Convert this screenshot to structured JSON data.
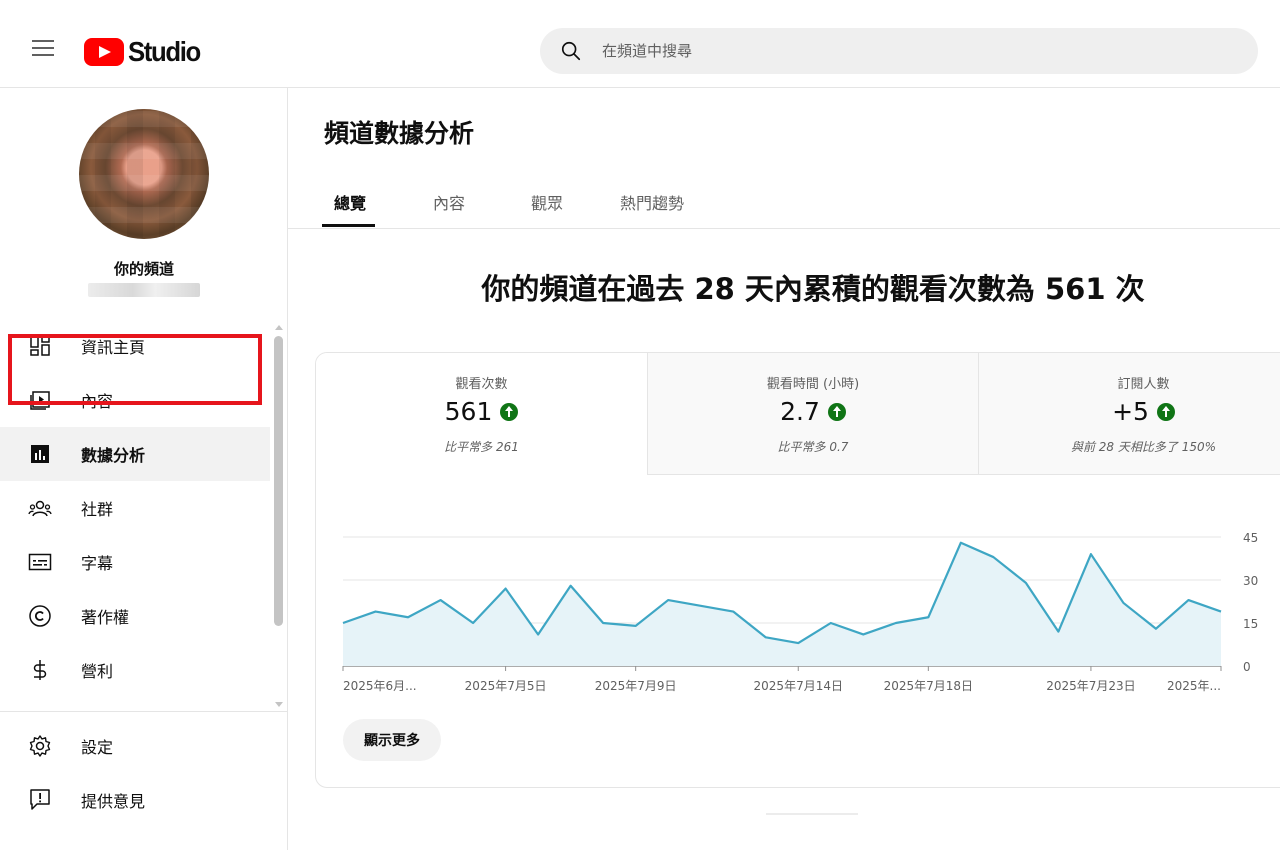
{
  "header": {
    "logo_text": "Studio",
    "search_placeholder": "在頻道中搜尋"
  },
  "sidebar": {
    "channel_label": "你的頻道",
    "items": [
      {
        "label": "資訊主頁",
        "icon": "dashboard-icon"
      },
      {
        "label": "內容",
        "icon": "content-icon"
      },
      {
        "label": "數據分析",
        "icon": "analytics-icon",
        "active": true
      },
      {
        "label": "社群",
        "icon": "community-icon"
      },
      {
        "label": "字幕",
        "icon": "subtitles-icon"
      },
      {
        "label": "著作權",
        "icon": "copyright-icon"
      },
      {
        "label": "營利",
        "icon": "dollar-icon"
      }
    ],
    "bottom_items": [
      {
        "label": "設定",
        "icon": "settings-gear-icon"
      },
      {
        "label": "提供意見",
        "icon": "feedback-icon"
      }
    ]
  },
  "main": {
    "title": "頻道數據分析",
    "tabs": [
      "總覽",
      "內容",
      "觀眾",
      "熱門趨勢"
    ],
    "active_tab": 0,
    "headline": "你的頻道在過去 28 天內累積的觀看次數為 561 次",
    "metrics": [
      {
        "label": "觀看次數",
        "value": "561",
        "trend": "up",
        "sub": "比平常多 261"
      },
      {
        "label": "觀看時間 (小時)",
        "value": "2.7",
        "trend": "up",
        "sub": "比平常多 0.7"
      },
      {
        "label": "訂閱人數",
        "value": "+5",
        "trend": "up",
        "sub": "與前 28 天相比多了 150%"
      }
    ],
    "show_more_label": "顯示更多"
  },
  "colors": {
    "accent_red": "#ff0000",
    "highlight_red": "#e6151c",
    "trend_green": "#107516",
    "line": "#3ea6c4",
    "area": "#e6f3f8"
  },
  "chart_data": {
    "type": "area",
    "x_tick_labels": [
      "2025年6月...",
      "2025年7月5日",
      "2025年7月9日",
      "2025年7月14日",
      "2025年7月18日",
      "2025年7月23日",
      "2025年..."
    ],
    "x_tick_index": [
      0,
      5,
      9,
      14,
      18,
      23,
      27
    ],
    "y_ticks": [
      0,
      15,
      30,
      45
    ],
    "ylim": [
      0,
      45
    ],
    "values": [
      15,
      19,
      17,
      23,
      15,
      27,
      11,
      28,
      15,
      14,
      23,
      21,
      19,
      10,
      8,
      15,
      11,
      15,
      17,
      43,
      38,
      29,
      12,
      39,
      22,
      13,
      23,
      19
    ],
    "grid": true
  }
}
